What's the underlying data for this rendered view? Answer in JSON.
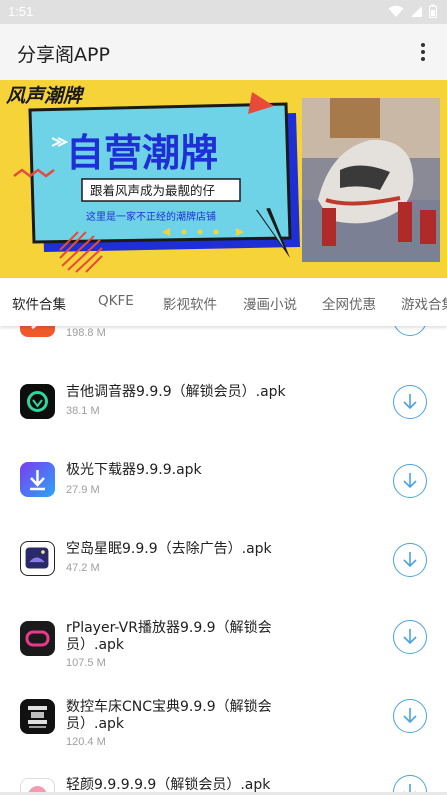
{
  "status_bar": {
    "time": "1:51",
    "icons": [
      "wifi-icon",
      "signal-icon",
      "battery-icon"
    ]
  },
  "app_bar": {
    "title": "分享阁APP",
    "menu_icon": "more-vert-icon"
  },
  "banner": {
    "brand": "风声潮牌",
    "headline": "自营潮牌",
    "tagline": "跟着风声成为最靓的仔",
    "subline": "这里是一家不正经的潮牌店铺",
    "photo_subject": "sneakers-photo",
    "colors": {
      "background": "#f7d33a",
      "panel": "#6fd3e8",
      "headline": "#1e2fd6",
      "accent": "#e84a3a"
    }
  },
  "tabs": [
    {
      "label": "软件合集",
      "active": true
    },
    {
      "label": "QKFE",
      "active": false
    },
    {
      "label": "影视软件",
      "active": false
    },
    {
      "label": "漫画小说",
      "active": false
    },
    {
      "label": "全网优惠",
      "active": false
    },
    {
      "label": "游戏合集",
      "active": false
    }
  ],
  "apps": [
    {
      "name": "",
      "size": "198.8 M",
      "icon": "orange-app-icon"
    },
    {
      "name": "吉他调音器9.9.9（解锁会员）.apk",
      "size": "38.1 M",
      "icon": "guitar-tuner-icon"
    },
    {
      "name": "极光下载器9.9.9.apk",
      "size": "27.9 M",
      "icon": "aurora-downloader-icon"
    },
    {
      "name": "空岛星眠9.9.9（去除广告）.apk",
      "size": "47.2 M",
      "icon": "sky-island-icon"
    },
    {
      "name": "rPlayer-VR播放器9.9.9（解锁会员）.apk",
      "size": "107.5 M",
      "icon": "rplayer-icon"
    },
    {
      "name": "数控车床CNC宝典9.9.9（解锁会员）.apk",
      "size": "120.4 M",
      "icon": "cnc-lathe-icon"
    },
    {
      "name": "轻颜9.9.9.9.9（解锁会员）.apk",
      "size": "",
      "icon": "qingyan-icon"
    }
  ],
  "accent_color": "#4aa3e0"
}
